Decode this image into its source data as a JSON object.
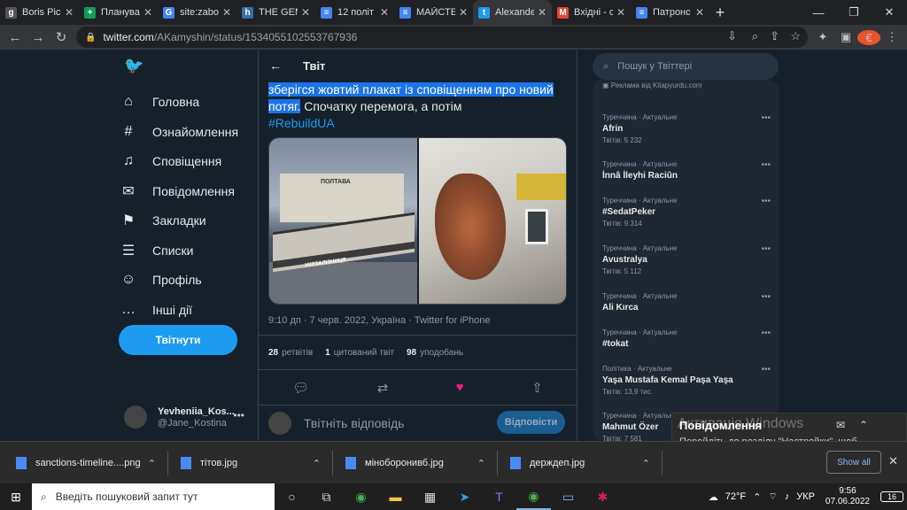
{
  "browser": {
    "tabs": [
      {
        "icon": "g",
        "label": "Boris Pic",
        "color": "#555"
      },
      {
        "icon": "+",
        "label": "Планува",
        "color": "#0f9d58"
      },
      {
        "icon": "G",
        "label": "site:zabo",
        "color": "#4285f4"
      },
      {
        "icon": "h",
        "label": "THE GEN",
        "color": "#3a6ea5"
      },
      {
        "icon": "≡",
        "label": "12 політ",
        "color": "#4285f4"
      },
      {
        "icon": "≡",
        "label": "МАЙСТЕ",
        "color": "#4285f4"
      },
      {
        "icon": "t",
        "label": "Alexande",
        "color": "#1d9bf0"
      },
      {
        "icon": "M",
        "label": "Вхідні - с",
        "color": "#ea4335"
      },
      {
        "icon": "≡",
        "label": "Патронс",
        "color": "#4285f4"
      }
    ],
    "url_domain": "twitter.com",
    "url_path": "/AKamyshin/status/1534055102553767936",
    "profile_initial": "€"
  },
  "nav": {
    "items": [
      {
        "icon": "⌂",
        "label": "Головна"
      },
      {
        "icon": "#",
        "label": "Ознайомлення"
      },
      {
        "icon": "♫",
        "label": "Сповіщення"
      },
      {
        "icon": "✉",
        "label": "Повідомлення"
      },
      {
        "icon": "⚑",
        "label": "Закладки"
      },
      {
        "icon": "☰",
        "label": "Списки"
      },
      {
        "icon": "☺",
        "label": "Профіль"
      },
      {
        "icon": "…",
        "label": "Інші дії"
      }
    ],
    "tweet_button": "Твітнути",
    "account_name": "Yevheniia_Kos...",
    "account_handle": "@Jane_Kostina"
  },
  "tweet": {
    "header": "Твіт",
    "highlighted_text": "зберігся жовтий плакат із сповіщенням про новий потяг.",
    "text_rest": " Спочатку перемога, а потім ",
    "hashtag": "#RebuildUA",
    "sign_text": "УКРЗАЛІЗНИЦЯ",
    "station_sign": "ПОЛТАВА",
    "meta": "9:10 дп · 7 черв. 2022, Україна · Twitter for iPhone",
    "retweets_count": "28",
    "retweets_label": "ретвітів",
    "quotes_count": "1",
    "quotes_label": "цитований твіт",
    "likes_count": "98",
    "likes_label": "уподобань",
    "reply_placeholder": "Твітніть відповідь",
    "reply_button": "Відповісти"
  },
  "sidebar": {
    "search_placeholder": "Пошук у Твіттері",
    "promo_label": "Реклама від Kitapyurdu.com",
    "trends": [
      {
        "cat": "Туреччина · Актуальне",
        "name": "Afrin",
        "count": "Твітів: 5 232"
      },
      {
        "cat": "Туреччина · Актуальне",
        "name": "İnnâ İleyhi Raciûn",
        "count": ""
      },
      {
        "cat": "Туреччина · Актуальне",
        "name": "#SedatPeker",
        "count": "Твітів: 9 314"
      },
      {
        "cat": "Туреччина · Актуальне",
        "name": "Avustralya",
        "count": "Твітів: 5 112"
      },
      {
        "cat": "Туреччина · Актуальне",
        "name": "Ali Kırca",
        "count": ""
      },
      {
        "cat": "Туреччина · Актуальне",
        "name": "#tokat",
        "count": ""
      },
      {
        "cat": "Політика · Актуальне",
        "name": "Yaşa Mustafa Kemal Paşa Yaşa",
        "count": "Твітів: 13,9 тис."
      },
      {
        "cat": "Туреччина · Актуальне",
        "name": "Mahmut Özer",
        "count": "Твітів: 7 581"
      }
    ]
  },
  "notification": {
    "title": "Повідомлення",
    "watermark": "Активація Windows",
    "body": "Перейдіть до розділу \"Настройки\", щоб активувати Windows.",
    "show_all": "Show all"
  },
  "downloads": [
    {
      "name": "sanctions-timeline....png"
    },
    {
      "name": "тітов.jpg"
    },
    {
      "name": "міноборонивб.jpg"
    },
    {
      "name": "держдеп.jpg"
    }
  ],
  "taskbar": {
    "search_placeholder": "Введіть пошуковий запит тут",
    "weather": "72°F",
    "lang": "УКР",
    "time": "9:56",
    "date": "07.06.2022",
    "notif_count": "16"
  }
}
